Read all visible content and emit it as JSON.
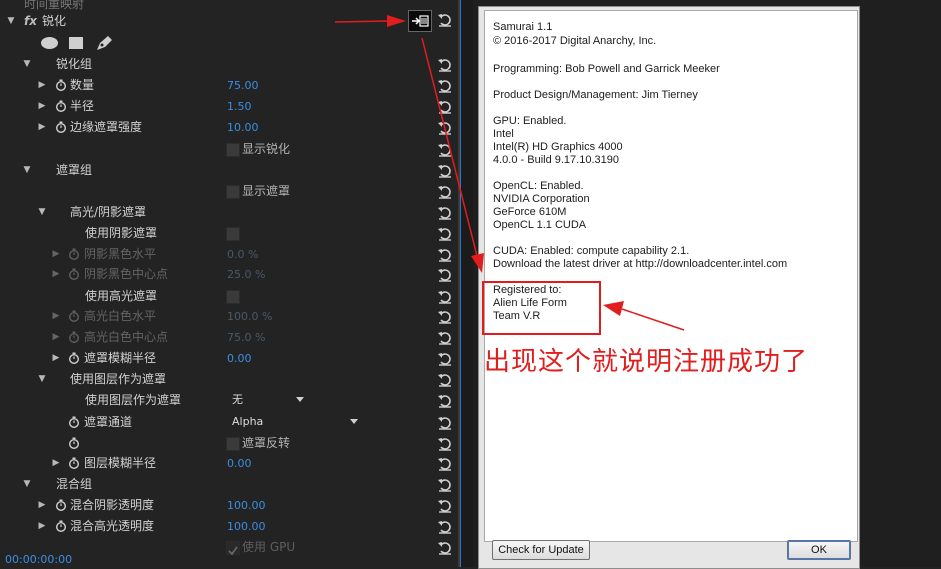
{
  "panel": {
    "top_effect": "时间重映射",
    "effect_title": "锐化",
    "fx_badge": "fx",
    "timecode": "00:00:00:00",
    "rows": [
      {
        "label": "锐化组"
      },
      {
        "label": "数量",
        "value": "75.00"
      },
      {
        "label": "半径",
        "value": "1.50"
      },
      {
        "label": "边缘遮罩强度",
        "value": "10.00"
      },
      {
        "checkbox_label": "显示锐化"
      },
      {
        "label": "遮罩组"
      },
      {
        "checkbox_label": "显示遮罩"
      },
      {
        "label": "高光/阴影遮罩"
      },
      {
        "label": "使用阴影遮罩"
      },
      {
        "label": "阴影黑色水平",
        "value": "0.0 %"
      },
      {
        "label": "阴影黑色中心点",
        "value": "25.0 %"
      },
      {
        "label": "使用高光遮罩"
      },
      {
        "label": "高光白色水平",
        "value": "100.0 %"
      },
      {
        "label": "高光白色中心点",
        "value": "75.0 %"
      },
      {
        "label": "遮罩模糊半径",
        "value": "0.00"
      },
      {
        "label": "使用图层作为遮罩"
      },
      {
        "label": "使用图层作为遮罩",
        "dropdown": "无"
      },
      {
        "label": "遮罩通道",
        "dropdown": "Alpha"
      },
      {
        "checkbox_label": "遮罩反转"
      },
      {
        "label": "图层模糊半径",
        "value": "0.00"
      },
      {
        "label": "混合组"
      },
      {
        "label": "混合阴影透明度",
        "value": "100.00"
      },
      {
        "label": "混合高光透明度",
        "value": "100.00"
      },
      {
        "checkbox_label": "使用 GPU"
      }
    ]
  },
  "dialog": {
    "lines": [
      "Samurai 1.1",
      "© 2016-2017 Digital Anarchy, Inc.",
      "Programming: Bob Powell and Garrick Meeker",
      "Product Design/Management: Jim Tierney",
      "GPU: Enabled.",
      "Intel",
      "Intel(R) HD Graphics 4000",
      "4.0.0 - Build 9.17.10.3190",
      "OpenCL: Enabled.",
      "NVIDIA Corporation",
      "GeForce 610M",
      "OpenCL 1.1 CUDA",
      "CUDA: Enabled: compute capability 2.1.",
      "Download the latest driver at http://downloadcenter.intel.com",
      "Registered to:",
      "Alien Life Form",
      "Team V.R"
    ],
    "check_update_label": "Check for Update",
    "ok_label": "OK"
  },
  "annotation": {
    "text": "出现这个就说明注册成功了",
    "color": "#e21d1d"
  },
  "colors": {
    "value_blue": "#3b8ee0",
    "panel_bg": "#232323"
  }
}
